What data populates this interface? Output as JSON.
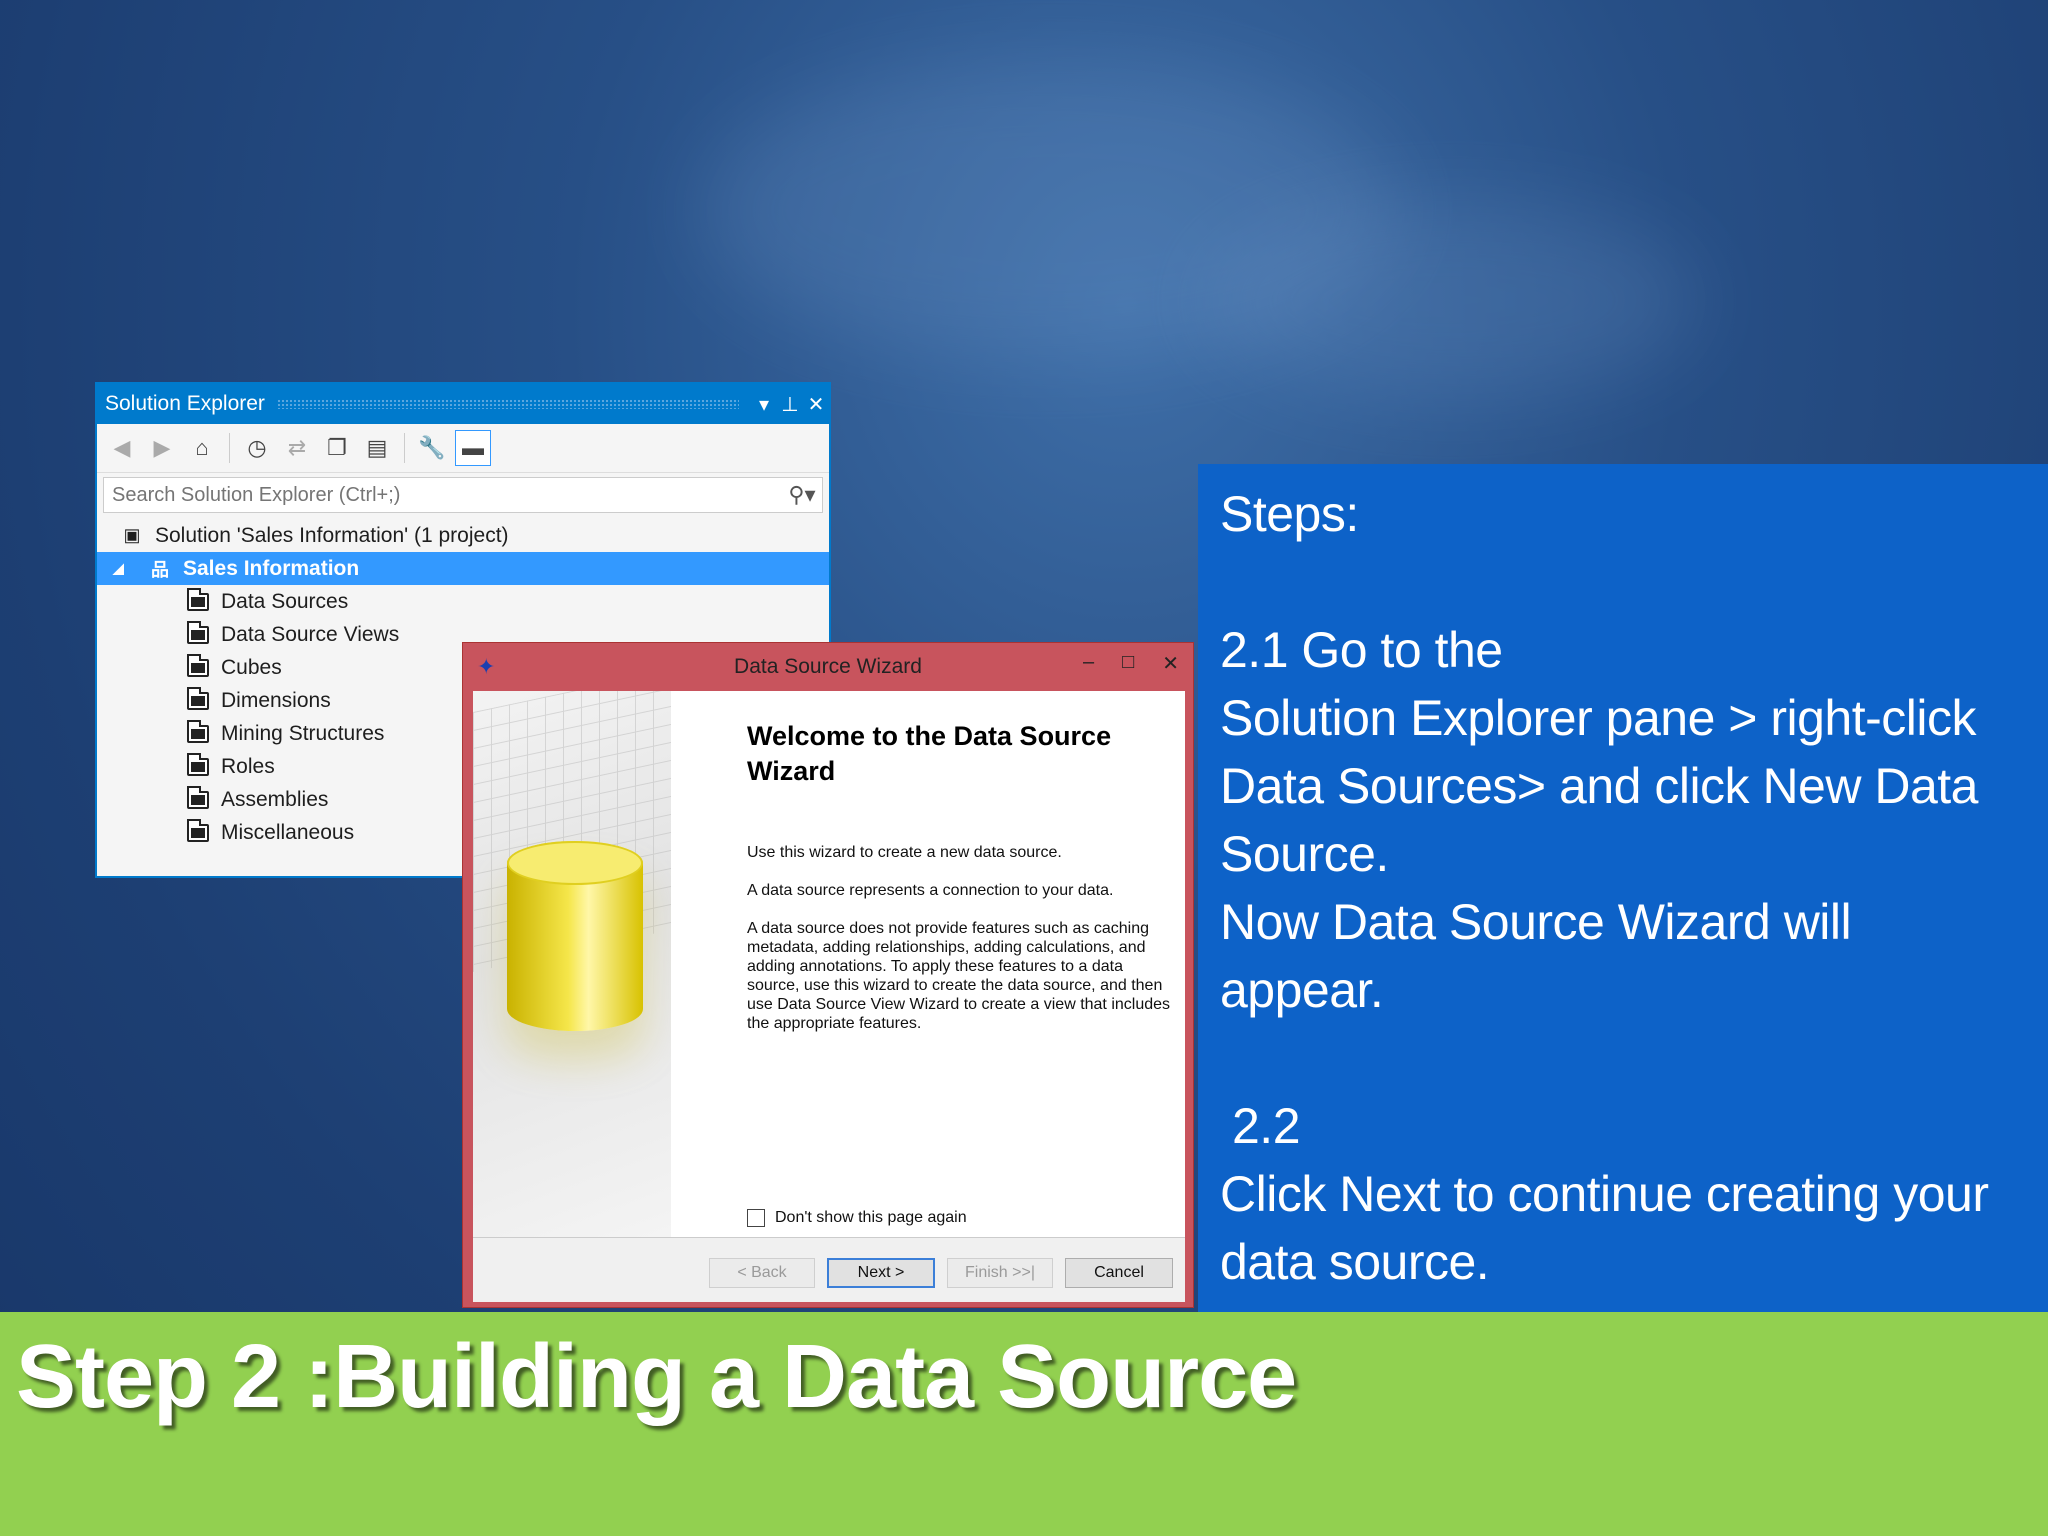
{
  "solution_explorer": {
    "title": "Solution Explorer",
    "search_placeholder": "Search Solution Explorer (Ctrl+;)",
    "tree": {
      "solution": "Solution 'Sales Information' (1 project)",
      "project": "Sales Information",
      "items": [
        "Data Sources",
        "Data Source Views",
        "Cubes",
        "Dimensions",
        "Mining Structures",
        "Roles",
        "Assemblies",
        "Miscellaneous"
      ]
    }
  },
  "wizard": {
    "title": "Data Source Wizard",
    "heading": "Welcome to the Data Source Wizard",
    "para1": "Use this wizard to create a new data source.",
    "para2": "A data source represents a connection to your data.",
    "para3": "A data source does not provide features such as caching metadata, adding relationships, adding calculations, and adding annotations. To apply these features to a data source, use this wizard to create the data source, and then use Data Source View Wizard to create a view that includes the appropriate features.",
    "checkbox_label": "Don't show this page again",
    "buttons": {
      "back": "< Back",
      "next": "Next >",
      "finish": "Finish >>|",
      "cancel": "Cancel"
    }
  },
  "steps": {
    "heading": "Steps:",
    "s21_num": "2.1 Go to the",
    "s21_line2": "Solution Explorer pane > right-click",
    "s21_line3": "Data Sources> and click New Data",
    "s21_line4": "Source.",
    "s21_line5": "Now Data Source Wizard will appear.",
    "s22_num": "2.2",
    "s22_line2": "Click Next to continue creating your",
    "s22_line3": "data source."
  },
  "banner": {
    "title": "Step 2 :Building a Data Source"
  },
  "colors": {
    "steps_bg": "#0d62c8",
    "banner_bg": "#92d050",
    "vs_accent": "#007acc",
    "wizard_frame": "#c8545d"
  }
}
